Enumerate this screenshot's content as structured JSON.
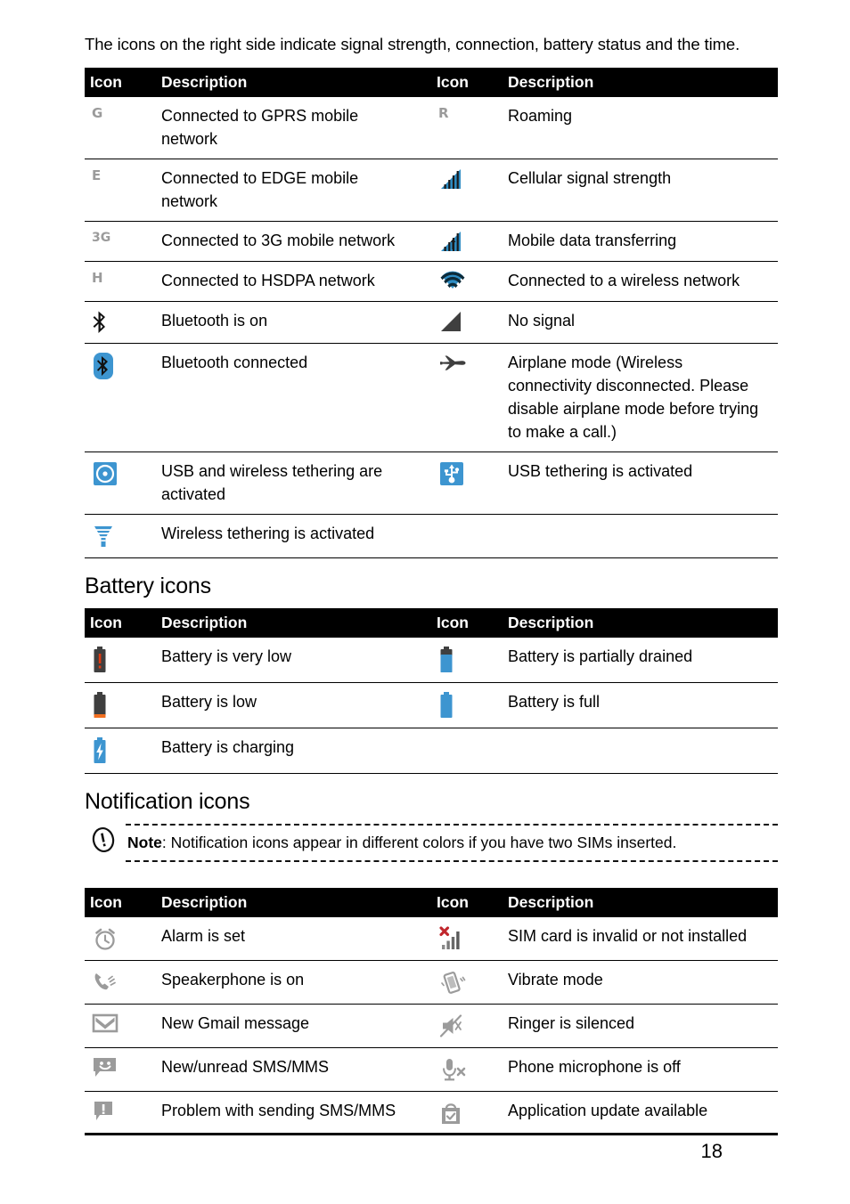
{
  "document": {
    "intro": "The icons on the right side indicate signal strength, connection, battery status and the time.",
    "page_number": "18"
  },
  "table_headers": {
    "icon": "Icon",
    "description": "Description"
  },
  "status_table": {
    "rows": [
      {
        "icon_left": "gprs-g-letter",
        "desc_left": "Connected to GPRS mobile network",
        "icon_right": "roaming-r-letter",
        "desc_right": "Roaming"
      },
      {
        "icon_left": "edge-e-letter",
        "desc_left": "Connected to EDGE mobile network",
        "icon_right": "cellular-signal-bars",
        "desc_right": "Cellular signal strength"
      },
      {
        "icon_left": "three-g-letter",
        "desc_left": "Connected to 3G mobile network",
        "icon_right": "mobile-data-transfer-bars",
        "desc_right": "Mobile data transferring"
      },
      {
        "icon_left": "hsdpa-h-letter",
        "desc_left": "Connected to HSDPA network",
        "icon_right": "wifi-icon",
        "desc_right": "Connected to a wireless network"
      },
      {
        "icon_left": "bluetooth-on-icon",
        "desc_left": "Bluetooth is on",
        "icon_right": "no-signal-icon",
        "desc_right": "No signal"
      },
      {
        "icon_left": "bluetooth-connected-icon",
        "desc_left": "Bluetooth connected",
        "icon_right": "airplane-mode-icon",
        "desc_right": "Airplane mode (Wireless connectivity disconnected. Please disable airplane mode before trying to make a call.)"
      },
      {
        "icon_left": "usb-wireless-tethering-icon",
        "desc_left": "USB and wireless tethering are activated",
        "icon_right": "usb-tethering-icon",
        "desc_right": "USB tethering is activated"
      },
      {
        "icon_left": "wireless-tethering-icon",
        "desc_left": "Wireless tethering is activated",
        "icon_right": "",
        "desc_right": ""
      }
    ]
  },
  "battery_section": {
    "heading": "Battery icons",
    "rows": [
      {
        "icon_left": "battery-very-low-icon",
        "desc_left": "Battery is very low",
        "icon_right": "battery-partially-drained-icon",
        "desc_right": "Battery is partially drained"
      },
      {
        "icon_left": "battery-low-icon",
        "desc_left": "Battery is low",
        "icon_right": "battery-full-icon",
        "desc_right": "Battery is full"
      },
      {
        "icon_left": "battery-charging-icon",
        "desc_left": "Battery is charging",
        "icon_right": "",
        "desc_right": ""
      }
    ]
  },
  "notification_section": {
    "heading": "Notification icons",
    "note": {
      "icon": "note-exclamation-icon",
      "label": "Note",
      "separator": ": ",
      "text": "Notification icons appear in different colors if you have two SIMs inserted."
    },
    "rows": [
      {
        "icon_left": "alarm-clock-icon",
        "desc_left": "Alarm is set",
        "icon_right": "sim-invalid-icon",
        "desc_right": "SIM card is invalid or not installed"
      },
      {
        "icon_left": "speakerphone-icon",
        "desc_left": "Speakerphone is on",
        "icon_right": "vibrate-mode-icon",
        "desc_right": "Vibrate mode"
      },
      {
        "icon_left": "gmail-icon",
        "desc_left": "New Gmail message",
        "icon_right": "ringer-silenced-icon",
        "desc_right": "Ringer is silenced"
      },
      {
        "icon_left": "sms-unread-icon",
        "desc_left": "New/unread SMS/MMS",
        "icon_right": "microphone-off-icon",
        "desc_right": "Phone microphone is off"
      },
      {
        "icon_left": "sms-problem-icon",
        "desc_left": "Problem with sending SMS/MMS",
        "icon_right": "app-update-icon",
        "desc_right": "Application update available"
      }
    ]
  },
  "colors": {
    "accent_blue": "#3d95d0",
    "signal_blue": "#2e8dc4",
    "battery_blue": "#3d95d0",
    "battery_dark": "#3f3f3f",
    "battery_red": "#e03a10",
    "battery_orange": "#f26f20",
    "notification_gray": "#9b9b9b",
    "letter_gray": "#9b9b9b",
    "header_black": "#000000",
    "sim_x_red": "#c1272d"
  }
}
